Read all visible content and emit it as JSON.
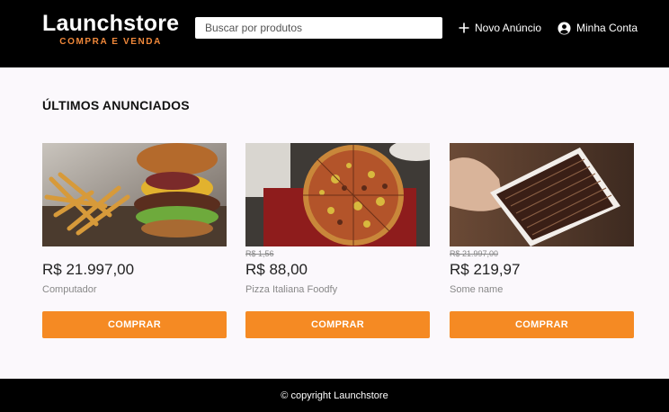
{
  "header": {
    "brand_title": "Launchstore",
    "brand_subtitle": "COMPRA E VENDA",
    "search_placeholder": "Buscar por produtos",
    "new_listing_label": "Novo Anúncio",
    "account_label": "Minha Conta"
  },
  "main": {
    "section_title": "ÚLTIMOS ANUNCIADOS",
    "products": [
      {
        "old_price": "",
        "price": "R$ 21.997,00",
        "name": "Computador",
        "button": "COMPRAR",
        "image": "burger-photo"
      },
      {
        "old_price": "R$ 1,56",
        "price": "R$ 88,00",
        "name": "Pizza Italiana Foodfy",
        "button": "COMPRAR",
        "image": "pizza-photo"
      },
      {
        "old_price": "R$ 21.997,00",
        "price": "R$ 219,97",
        "name": "Some name",
        "button": "COMPRAR",
        "image": "chocolate-box-photo"
      }
    ]
  },
  "footer": {
    "text": "© copyright Launchstore"
  },
  "colors": {
    "header_bg": "#000000",
    "accent": "#f58a23",
    "brand_subtitle": "#f0883a",
    "page_bg": "#fbf8fc"
  },
  "icons": {
    "new_listing": "plus-icon",
    "account": "account-circle-icon"
  }
}
